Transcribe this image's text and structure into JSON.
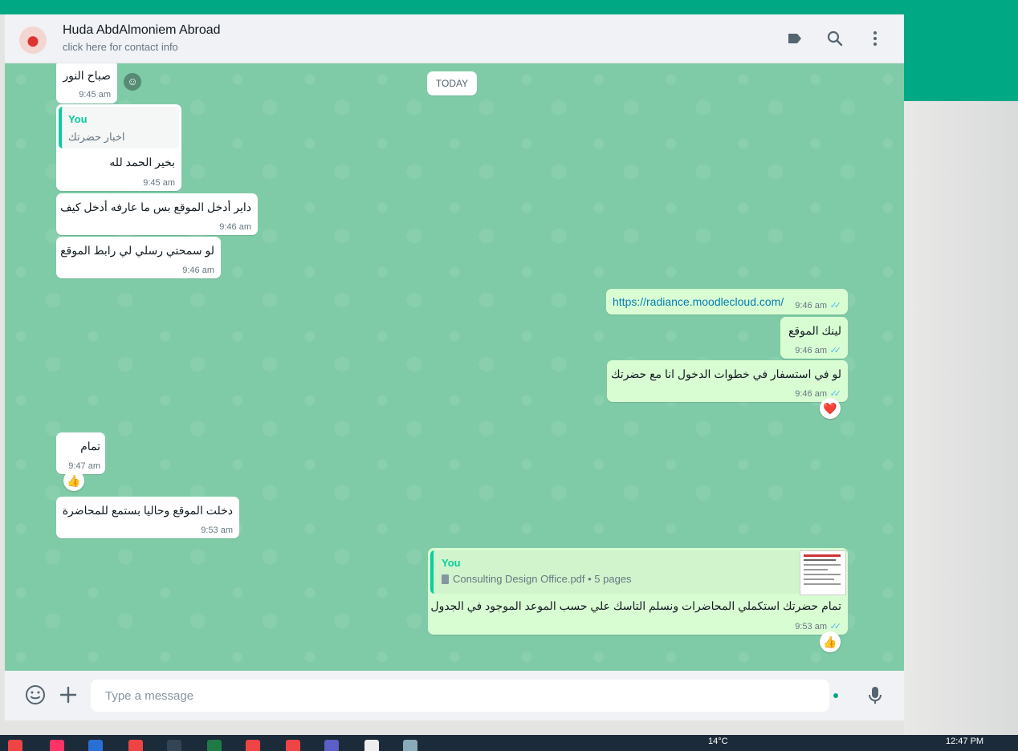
{
  "header": {
    "contact_name": "Huda AbdAlmoniem Abroad",
    "contact_sub": "click here for contact info"
  },
  "chat": {
    "date_divider": "TODAY",
    "messages": [
      {
        "text": "صباح النور",
        "time": "9:45 am"
      },
      {
        "quote_name": "You",
        "quote_text": "اخبار حضرتك",
        "text": "بخير الحمد لله",
        "time": "9:45 am"
      },
      {
        "text": "داير أدخل الموقع بس ما عارفه أدخل كيف",
        "time": "9:46 am"
      },
      {
        "text": "لو سمحتي رسلي لي رابط الموقع",
        "time": "9:46 am"
      },
      {
        "text": "https://radiance.moodlecloud.com/",
        "time": "9:46 am"
      },
      {
        "text": "لينك الموقع",
        "time": "9:46 am"
      },
      {
        "text": "لو في استسفار في خطوات الدخول انا مع حضرتك",
        "time": "9:46 am",
        "reaction": "❤️"
      },
      {
        "text": "تمام",
        "time": "9:47 am",
        "reaction": "👍"
      },
      {
        "text": "دخلت الموقع وحاليا بستمع للمحاضرة",
        "time": "9:53 am"
      },
      {
        "quote_name": "You",
        "quote_text": "Consulting Design Office.pdf • 5 pages",
        "text": "تمام حضرتك استكملي المحاضرات  ونسلم التاسك علي حسب الموعد الموجود في الجدول",
        "time": "9:53 am",
        "reaction": "👍"
      }
    ]
  },
  "footer": {
    "placeholder": "Type a message"
  },
  "taskbar": {
    "weather": "14°C",
    "time": "12:47 PM"
  },
  "colors": {
    "accent": "#00a884",
    "chat_bg": "#80cba7",
    "incoming": "#ffffff",
    "outgoing": "#d9fdd3",
    "ticks": "#53bdeb"
  }
}
